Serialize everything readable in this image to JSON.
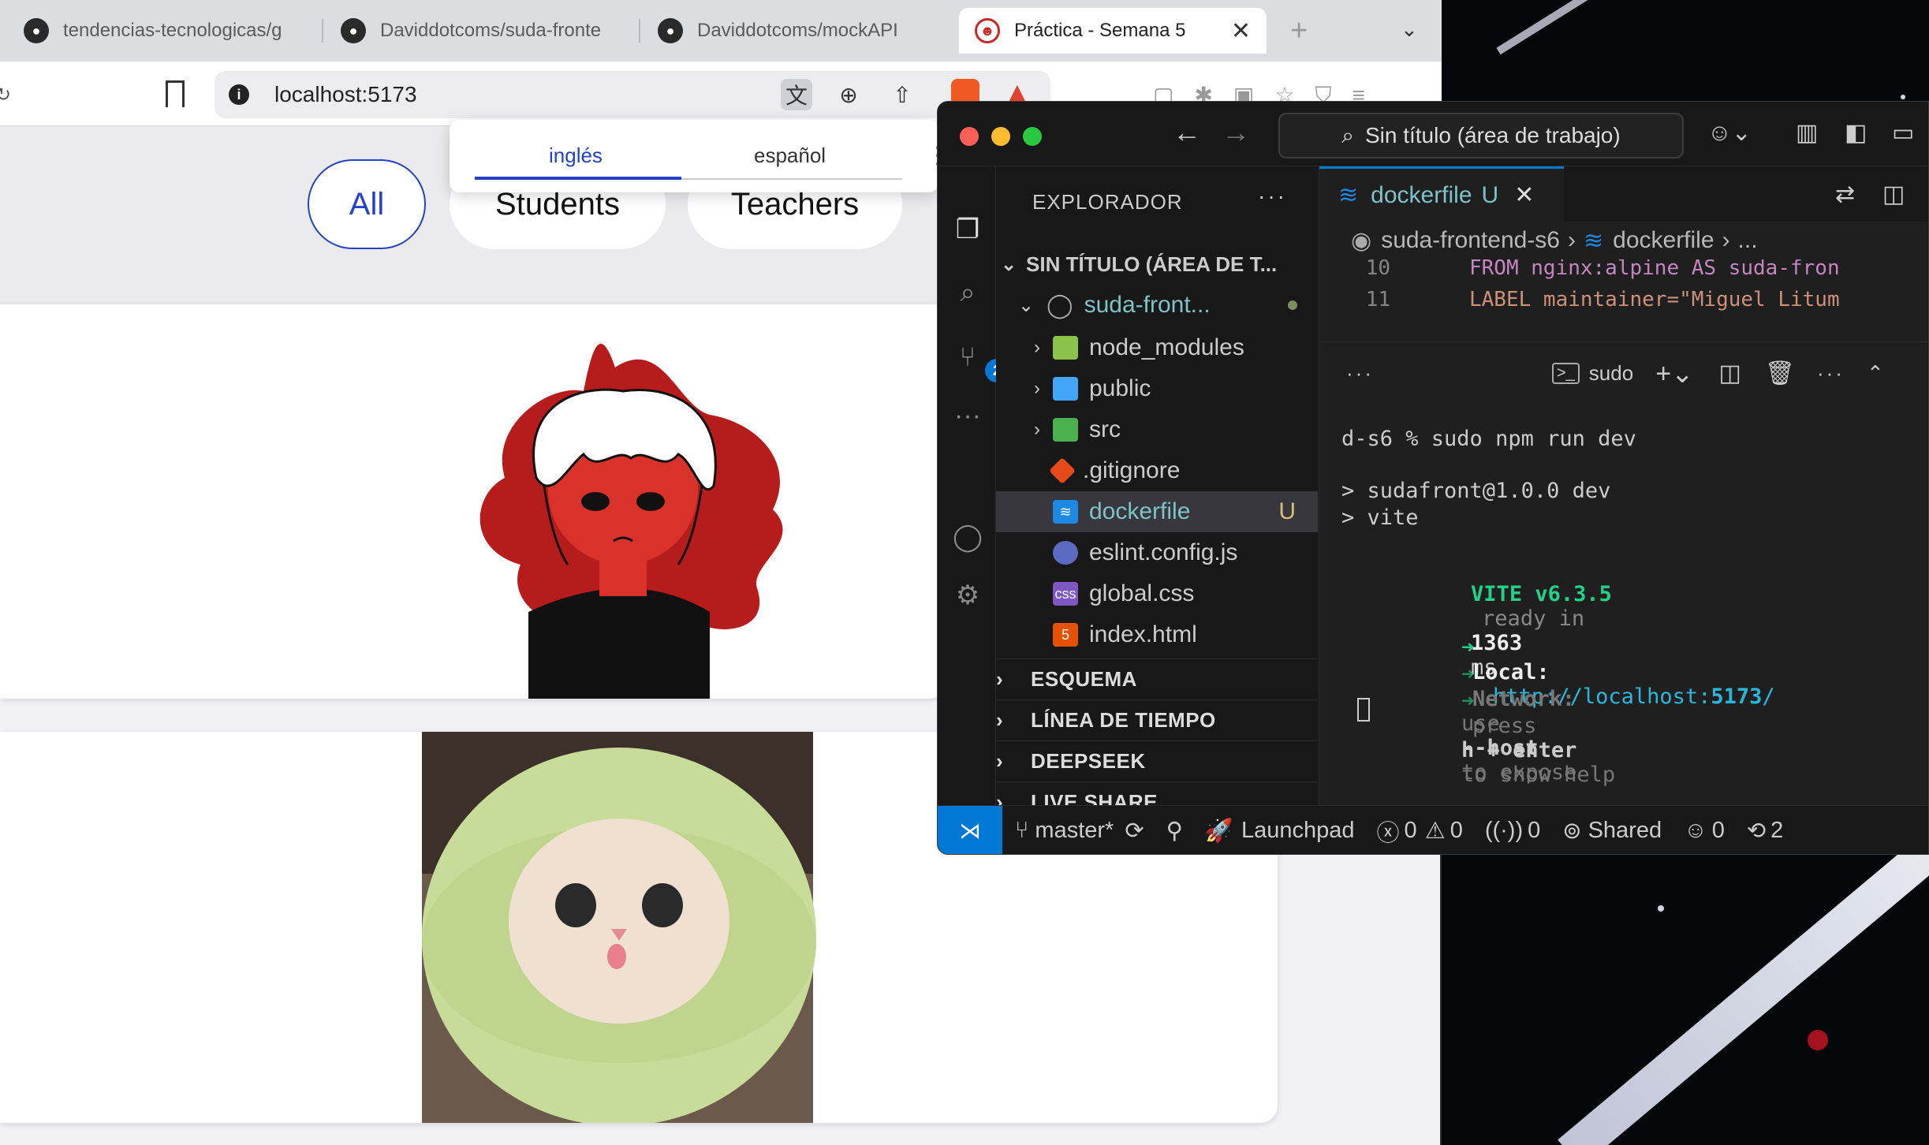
{
  "browser": {
    "tabs": [
      {
        "title": "tendencias-tecnologicas/g",
        "icon": "github-icon"
      },
      {
        "title": "Daviddotcoms/suda-fronte",
        "icon": "github-icon"
      },
      {
        "title": "Daviddotcoms/mockAPI",
        "icon": "github-icon"
      },
      {
        "title": "Práctica - Semana 5",
        "icon": "avatar-icon",
        "active": true
      }
    ],
    "new_tab": "+",
    "close": "✕",
    "url": "localhost:5173",
    "translate": {
      "lang1": "inglés",
      "lang2": "español"
    }
  },
  "page": {
    "filters": [
      "All",
      "Students",
      "Teachers"
    ],
    "active_filter": "All",
    "accent": "#2342c8"
  },
  "vscode": {
    "search": "Sin título (área de trabajo)",
    "explorer_title": "EXPLORADOR",
    "more": "···",
    "workspace": "SIN TÍTULO (ÁREA DE T...",
    "project": "suda-front...",
    "files": [
      {
        "name": "node_modules",
        "type": "folder",
        "color": "#8bc34a"
      },
      {
        "name": "public",
        "type": "folder",
        "color": "#42a5f5"
      },
      {
        "name": "src",
        "type": "folder",
        "color": "#4caf50"
      },
      {
        "name": ".gitignore",
        "type": "file",
        "color": "#e64a19"
      },
      {
        "name": "dockerfile",
        "type": "file",
        "color": "#1e88e5",
        "status": "U",
        "selected": true
      },
      {
        "name": "eslint.config.js",
        "type": "file",
        "color": "#5c6bc0"
      },
      {
        "name": "global.css",
        "type": "file",
        "color": "#7e57c2"
      },
      {
        "name": "index.html",
        "type": "file",
        "color": "#e65100"
      }
    ],
    "sections": [
      "ESQUEMA",
      "LÍNEA DE TIEMPO",
      "DEEPSEEK",
      "LIVE SHARE"
    ],
    "scm_badge": "2",
    "editor_tab": "dockerfile",
    "editor_tab_status": "U",
    "breadcrumb": [
      "suda-frontend-s6",
      "dockerfile",
      "..."
    ],
    "code": [
      {
        "ln": "10",
        "text": "FROM nginx:alpine AS suda-fron"
      },
      {
        "ln": "11",
        "text": "LABEL maintainer=\"Miguel Litum"
      }
    ],
    "terminal_name": "sudo",
    "terminal": {
      "cmd": "d-s6 % sudo npm run dev",
      "out1": "> sudafront@1.0.0 dev",
      "out2": "> vite",
      "vite": "VITE v6.3.5",
      "ready_pre": "ready in",
      "ready_ms": "1363",
      "ready_unit": "ms",
      "local_label": "Local:",
      "local_url_pre": "http://localhost:",
      "local_port": "5173",
      "local_slash": "/",
      "network_label": "Network:",
      "network_pre": "use",
      "network_flag": "--host",
      "network_post": "to expose",
      "press_pre": "press",
      "press_h": "h + enter",
      "press_post": "to show help"
    },
    "status": {
      "branch": "master*",
      "launchpad": "Launchpad",
      "errors": "0",
      "warnings": "0",
      "ports": "0",
      "shared": "Shared",
      "copilot": "0",
      "history": "2"
    }
  }
}
